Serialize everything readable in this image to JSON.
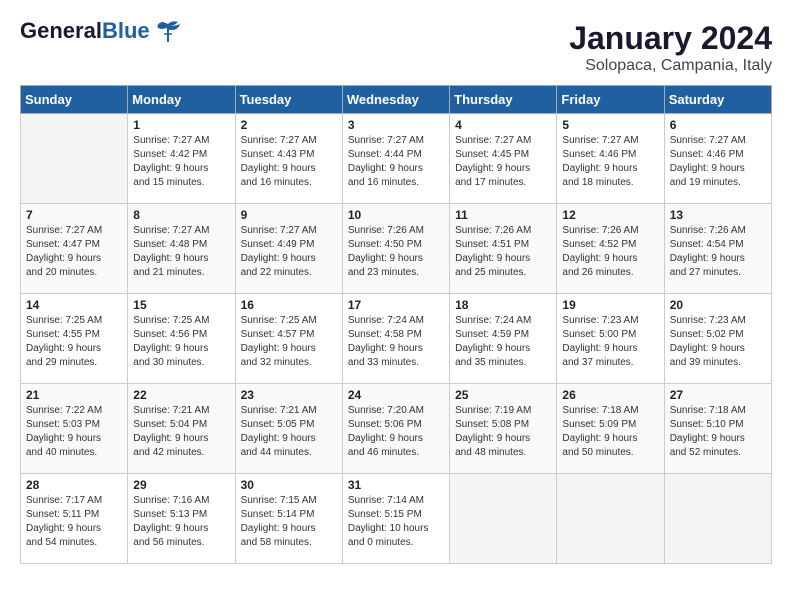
{
  "logo": {
    "general": "General",
    "blue": "Blue"
  },
  "title": "January 2024",
  "subtitle": "Solopaca, Campania, Italy",
  "days_of_week": [
    "Sunday",
    "Monday",
    "Tuesday",
    "Wednesday",
    "Thursday",
    "Friday",
    "Saturday"
  ],
  "weeks": [
    [
      {
        "day": null,
        "info": null
      },
      {
        "day": "1",
        "info": "Sunrise: 7:27 AM\nSunset: 4:42 PM\nDaylight: 9 hours\nand 15 minutes."
      },
      {
        "day": "2",
        "info": "Sunrise: 7:27 AM\nSunset: 4:43 PM\nDaylight: 9 hours\nand 16 minutes."
      },
      {
        "day": "3",
        "info": "Sunrise: 7:27 AM\nSunset: 4:44 PM\nDaylight: 9 hours\nand 16 minutes."
      },
      {
        "day": "4",
        "info": "Sunrise: 7:27 AM\nSunset: 4:45 PM\nDaylight: 9 hours\nand 17 minutes."
      },
      {
        "day": "5",
        "info": "Sunrise: 7:27 AM\nSunset: 4:46 PM\nDaylight: 9 hours\nand 18 minutes."
      },
      {
        "day": "6",
        "info": "Sunrise: 7:27 AM\nSunset: 4:46 PM\nDaylight: 9 hours\nand 19 minutes."
      }
    ],
    [
      {
        "day": "7",
        "info": "Sunrise: 7:27 AM\nSunset: 4:47 PM\nDaylight: 9 hours\nand 20 minutes."
      },
      {
        "day": "8",
        "info": "Sunrise: 7:27 AM\nSunset: 4:48 PM\nDaylight: 9 hours\nand 21 minutes."
      },
      {
        "day": "9",
        "info": "Sunrise: 7:27 AM\nSunset: 4:49 PM\nDaylight: 9 hours\nand 22 minutes."
      },
      {
        "day": "10",
        "info": "Sunrise: 7:26 AM\nSunset: 4:50 PM\nDaylight: 9 hours\nand 23 minutes."
      },
      {
        "day": "11",
        "info": "Sunrise: 7:26 AM\nSunset: 4:51 PM\nDaylight: 9 hours\nand 25 minutes."
      },
      {
        "day": "12",
        "info": "Sunrise: 7:26 AM\nSunset: 4:52 PM\nDaylight: 9 hours\nand 26 minutes."
      },
      {
        "day": "13",
        "info": "Sunrise: 7:26 AM\nSunset: 4:54 PM\nDaylight: 9 hours\nand 27 minutes."
      }
    ],
    [
      {
        "day": "14",
        "info": "Sunrise: 7:25 AM\nSunset: 4:55 PM\nDaylight: 9 hours\nand 29 minutes."
      },
      {
        "day": "15",
        "info": "Sunrise: 7:25 AM\nSunset: 4:56 PM\nDaylight: 9 hours\nand 30 minutes."
      },
      {
        "day": "16",
        "info": "Sunrise: 7:25 AM\nSunset: 4:57 PM\nDaylight: 9 hours\nand 32 minutes."
      },
      {
        "day": "17",
        "info": "Sunrise: 7:24 AM\nSunset: 4:58 PM\nDaylight: 9 hours\nand 33 minutes."
      },
      {
        "day": "18",
        "info": "Sunrise: 7:24 AM\nSunset: 4:59 PM\nDaylight: 9 hours\nand 35 minutes."
      },
      {
        "day": "19",
        "info": "Sunrise: 7:23 AM\nSunset: 5:00 PM\nDaylight: 9 hours\nand 37 minutes."
      },
      {
        "day": "20",
        "info": "Sunrise: 7:23 AM\nSunset: 5:02 PM\nDaylight: 9 hours\nand 39 minutes."
      }
    ],
    [
      {
        "day": "21",
        "info": "Sunrise: 7:22 AM\nSunset: 5:03 PM\nDaylight: 9 hours\nand 40 minutes."
      },
      {
        "day": "22",
        "info": "Sunrise: 7:21 AM\nSunset: 5:04 PM\nDaylight: 9 hours\nand 42 minutes."
      },
      {
        "day": "23",
        "info": "Sunrise: 7:21 AM\nSunset: 5:05 PM\nDaylight: 9 hours\nand 44 minutes."
      },
      {
        "day": "24",
        "info": "Sunrise: 7:20 AM\nSunset: 5:06 PM\nDaylight: 9 hours\nand 46 minutes."
      },
      {
        "day": "25",
        "info": "Sunrise: 7:19 AM\nSunset: 5:08 PM\nDaylight: 9 hours\nand 48 minutes."
      },
      {
        "day": "26",
        "info": "Sunrise: 7:18 AM\nSunset: 5:09 PM\nDaylight: 9 hours\nand 50 minutes."
      },
      {
        "day": "27",
        "info": "Sunrise: 7:18 AM\nSunset: 5:10 PM\nDaylight: 9 hours\nand 52 minutes."
      }
    ],
    [
      {
        "day": "28",
        "info": "Sunrise: 7:17 AM\nSunset: 5:11 PM\nDaylight: 9 hours\nand 54 minutes."
      },
      {
        "day": "29",
        "info": "Sunrise: 7:16 AM\nSunset: 5:13 PM\nDaylight: 9 hours\nand 56 minutes."
      },
      {
        "day": "30",
        "info": "Sunrise: 7:15 AM\nSunset: 5:14 PM\nDaylight: 9 hours\nand 58 minutes."
      },
      {
        "day": "31",
        "info": "Sunrise: 7:14 AM\nSunset: 5:15 PM\nDaylight: 10 hours\nand 0 minutes."
      },
      {
        "day": null,
        "info": null
      },
      {
        "day": null,
        "info": null
      },
      {
        "day": null,
        "info": null
      }
    ]
  ]
}
